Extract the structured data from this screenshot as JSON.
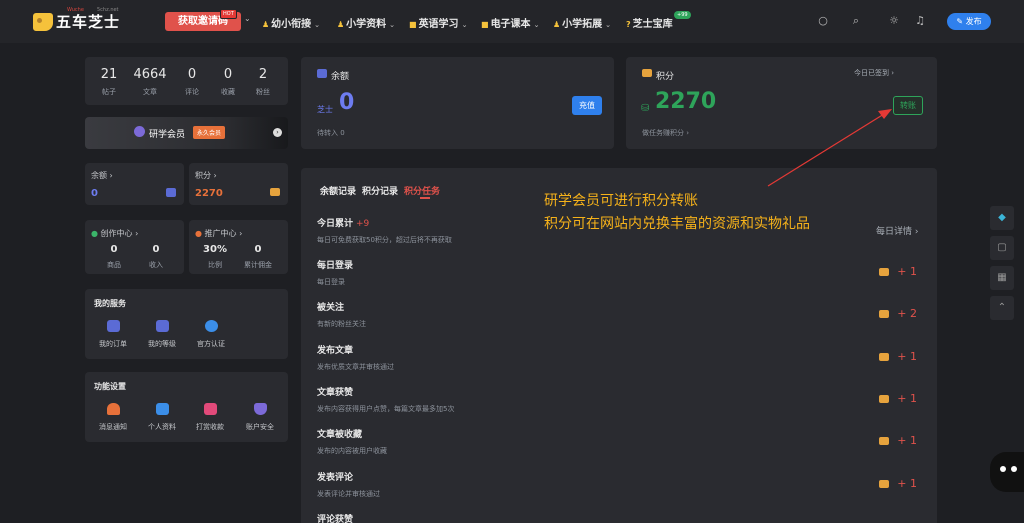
{
  "nav": {
    "logo_text": "五车芝士",
    "logo_tag": "Wuche",
    "logo_tag2": "5chz.net",
    "invite_label": "获取邀请码",
    "invite_badge": "HOT",
    "menu": [
      {
        "label": "幼小衔接"
      },
      {
        "label": "小学资料"
      },
      {
        "label": "英语学习"
      },
      {
        "label": "电子课本"
      },
      {
        "label": "小学拓展"
      },
      {
        "label": "芝士宝库",
        "badge": "+99"
      }
    ],
    "post_label": "发布"
  },
  "profile_stats": [
    {
      "value": "21",
      "label": "帖子"
    },
    {
      "value": "4664",
      "label": "文章"
    },
    {
      "value": "0",
      "label": "评论"
    },
    {
      "value": "0",
      "label": "收藏"
    },
    {
      "value": "2",
      "label": "粉丝"
    }
  ],
  "membership": {
    "label": "研学会员",
    "tag": "永久会员"
  },
  "mini": {
    "balance_label": "余额",
    "balance_value": "0",
    "points_label": "积分",
    "points_value": "2270"
  },
  "creation": {
    "title": "创作中心",
    "items": [
      {
        "value": "0",
        "label": "商品"
      },
      {
        "value": "0",
        "label": "收入"
      }
    ]
  },
  "promo": {
    "title": "推广中心",
    "items": [
      {
        "value": "30%",
        "label": "比例"
      },
      {
        "value": "0",
        "label": "累计佣金"
      }
    ]
  },
  "services": {
    "title": "我的服务",
    "items": [
      {
        "label": "我的订单"
      },
      {
        "label": "我的等级"
      },
      {
        "label": "官方认证"
      }
    ]
  },
  "settings": {
    "title": "功能设置",
    "items": [
      {
        "label": "消息通知"
      },
      {
        "label": "个人资料"
      },
      {
        "label": "打赏收款"
      },
      {
        "label": "账户安全"
      }
    ]
  },
  "balance_card": {
    "title": "余额",
    "currency": "芝士",
    "amount": "0",
    "pending": "待转入 0",
    "recharge_label": "充值"
  },
  "points_card": {
    "title": "积分",
    "checked_in": "今日已签到",
    "amount": "2270",
    "hint": "做任务赚积分",
    "transfer_label": "转账"
  },
  "tabs": {
    "balance_record": "余额记录",
    "points_record": "积分记录",
    "points_task": "积分任务"
  },
  "daily_detail": "每日详情",
  "tasks": [
    {
      "title": "今日累计",
      "plus": "+9",
      "desc": "每日可免费获取50积分，超过后将不再获取",
      "reward": ""
    },
    {
      "title": "每日登录",
      "plus": "",
      "desc": "每日登录",
      "reward": "+ 1"
    },
    {
      "title": "被关注",
      "plus": "",
      "desc": "有新的粉丝关注",
      "reward": "+ 2"
    },
    {
      "title": "发布文章",
      "plus": "",
      "desc": "发布优质文章并审核通过",
      "reward": "+ 1"
    },
    {
      "title": "文章获赞",
      "plus": "",
      "desc": "发布内容获得用户点赞，每篇文章最多加5次",
      "reward": "+ 1"
    },
    {
      "title": "文章被收藏",
      "plus": "",
      "desc": "发布的内容被用户收藏",
      "reward": "+ 1"
    },
    {
      "title": "发表评论",
      "plus": "",
      "desc": "发表评论并审核通过",
      "reward": "+ 1"
    },
    {
      "title": "评论获赞",
      "plus": "",
      "desc": "",
      "reward": ""
    }
  ],
  "annotation": {
    "line1": "研学会员可进行积分转账",
    "line2": "积分可在网站内兑换丰富的资源和实物礼品"
  }
}
